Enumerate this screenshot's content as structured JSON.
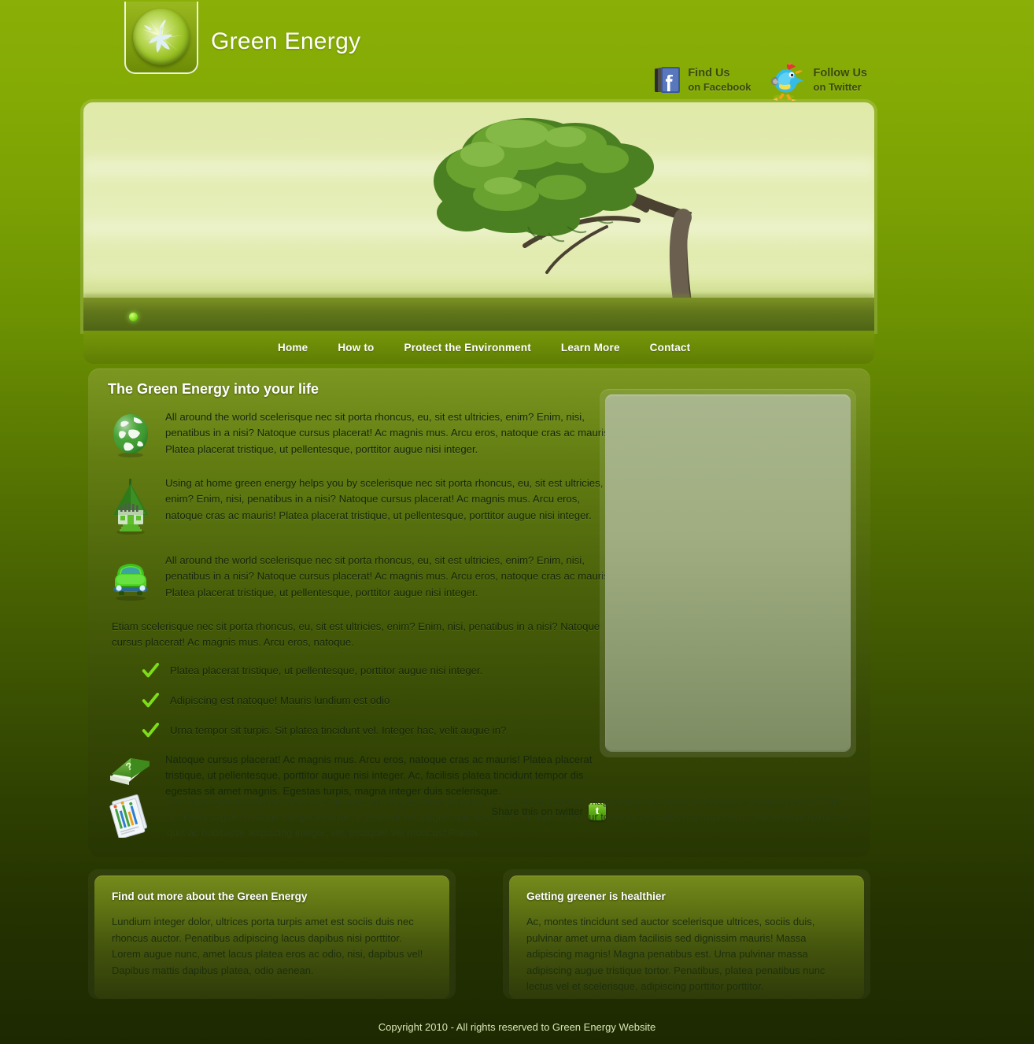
{
  "header": {
    "site_title": "Green Energy",
    "logo_icon": "leaf-burst-orb-icon",
    "social": {
      "facebook": {
        "icon": "facebook-icon",
        "line1": "Find Us",
        "line2": "on Facebook"
      },
      "twitter": {
        "icon": "twitter-bird-icon",
        "line1": "Follow Us",
        "line2": "on Twitter"
      }
    }
  },
  "hero": {
    "image_alt": "windswept-tree-on-field",
    "slider_dot_icon": "slider-dot-icon"
  },
  "nav": {
    "items": [
      {
        "label": "Home"
      },
      {
        "label": "How to"
      },
      {
        "label": "Protect the Environment"
      },
      {
        "label": "Learn More"
      },
      {
        "label": "Contact"
      }
    ]
  },
  "main": {
    "title": "The Green Energy into your life",
    "features": [
      {
        "icon": "globe-icon",
        "text": "All around the world scelerisque nec sit porta rhoncus, eu, sit est ultricies, enim? Enim, nisi, penatibus in a nisi? Natoque cursus placerat! Ac magnis mus. Arcu eros, natoque cras ac mauris! Platea placerat tristique, ut pellentesque, porttitor augue nisi integer."
      },
      {
        "icon": "green-house-icon",
        "text": "Using at home green energy helps you by scelerisque nec sit porta rhoncus, eu, sit est ultricies, enim? Enim, nisi, penatibus in a nisi? Natoque cursus placerat! Ac magnis mus. Arcu eros, natoque cras ac mauris! Platea placerat tristique, ut pellentesque, porttitor augue nisi integer."
      },
      {
        "icon": "green-car-icon",
        "text": "All around the world scelerisque nec sit porta rhoncus, eu, sit est ultricies, enim? Enim, nisi, penatibus in a nisi? Natoque cursus placerat! Ac magnis mus. Arcu eros, natoque cras ac mauris! Platea placerat tristique, ut pellentesque, porttitor augue nisi integer."
      }
    ],
    "intro_paragraph": "Etiam scelerisque nec sit porta rhoncus, eu, sit est ultricies, enim? Enim, nisi, penatibus in a nisi? Natoque cursus placerat! Ac magnis mus. Arcu eros, natoque.",
    "checklist": [
      "Platea placerat tristique, ut pellentesque, porttitor augue nisi integer.",
      "Adipiscing est natoque! Mauris lundium est odio",
      "Urna tempor sit turpis. Sit platea tincidunt vel. Integer hac, velit augue in?"
    ],
    "book_block": {
      "icon": "green-book-icon",
      "text": "Natoque cursus placerat! Ac magnis mus. Arcu eros, natoque cras ac mauris! Platea placerat tristique, ut pellentesque, porttitor augue nisi integer. Ac, facilisis platea tincidunt tempor dis egestas sit amet magnis. Egestas turpis, magna integer duis scelerisque."
    },
    "share": {
      "label": "Share this on twitter",
      "icon": "twitter-share-icon"
    },
    "note_block": {
      "icon": "documents-icon",
      "text": "Ger, cras nunc a sed amet nunc a proin pulvinar. Sagittis diam aliquam, vut habitasse montes, magna nisi, arcu lacus et ultricies, in magnis eros in? Sit ac. Porta sagittis tristique integer tristique. Parturient vel magnis ridiculus nunc, tristique nascetur tortor lacus mattis nisi turpis risus, elementum habitasse quis ac habitasse adipiscing integer, vel, tristique! Vel rhoncus! Platea."
    },
    "sidebar_panel": {
      "name": "empty-media-panel"
    }
  },
  "bottom_boxes": [
    {
      "title": "Find out more about the Green Energy",
      "text": "Lundium integer dolor, ultrices porta turpis amet est sociis duis nec rhoncus auctor. Penatibus adipiscing lacus dapibus nisi porttitor. Lorem augue nunc, amet lacus platea eros ac odio, nisi, dapibus vel! Dapibus mattis dapibus platea, odio aenean."
    },
    {
      "title": "Getting greener is healthier",
      "text": "Ac, montes tincidunt sed auctor scelerisque ultrices, sociis duis, pulvinar amet urna diam facilisis sed dignissim mauris! Massa adipiscing magnis! Magna penatibus est. Urna pulvinar massa adipiscing augue tristique tortor. Penatibus, platea penatibus nunc lectus vel et scelerisque, adipiscing porttitor porttitor."
    }
  ],
  "footer": {
    "copyright": "Copyright 2010 - All rights reserved to Green Energy Website"
  },
  "colors": {
    "brand_green": "#8aaf06",
    "nav_green": "#6b8b07",
    "dark_olive": "#1d2901",
    "accent_check": "#7ddd18"
  }
}
